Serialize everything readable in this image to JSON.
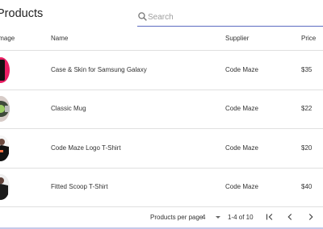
{
  "page": {
    "title": "Products"
  },
  "search": {
    "placeholder": "Search"
  },
  "table": {
    "columns": [
      "Image",
      "Name",
      "Supplier",
      "Price"
    ],
    "rows": [
      {
        "name": "Case & Skin for Samsung Galaxy",
        "supplier": "Code Maze",
        "price": "$35",
        "image_icon": "phone-case-thumbnail"
      },
      {
        "name": "Classic Mug",
        "supplier": "Code Maze",
        "price": "$22",
        "image_icon": "mug-thumbnail"
      },
      {
        "name": "Code Maze Logo T-Shirt",
        "supplier": "Code Maze",
        "price": "$20",
        "image_icon": "tshirt-thumbnail"
      },
      {
        "name": "Fitted Scoop T-Shirt",
        "supplier": "Code Maze",
        "price": "$40",
        "image_icon": "tshirt-thumbnail"
      }
    ]
  },
  "pagination": {
    "rows_per_page_label": "Products per page",
    "rows_per_page_value": "4",
    "range": "1-4 of 10"
  },
  "colors": {
    "accent": "#5c6bc0"
  }
}
